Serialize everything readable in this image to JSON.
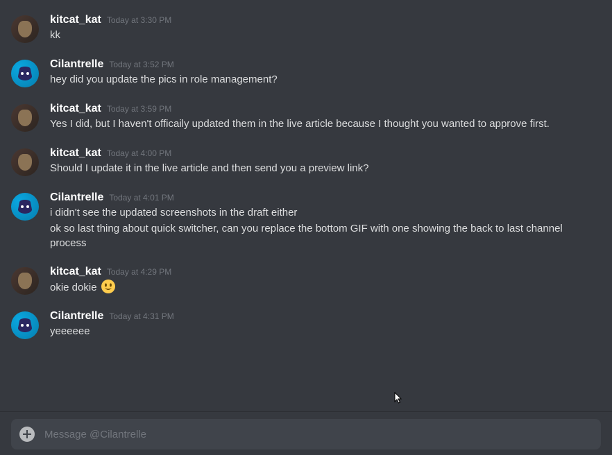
{
  "users": {
    "kitcat": {
      "name": "kitcat_kat"
    },
    "cilantrelle": {
      "name": "Cilantrelle"
    }
  },
  "messages": [
    {
      "user": "kitcat",
      "time": "Today at 3:30 PM",
      "lines": [
        "kk"
      ]
    },
    {
      "user": "cilantrelle",
      "time": "Today at 3:52 PM",
      "lines": [
        "hey did you update the pics in role management?"
      ]
    },
    {
      "user": "kitcat",
      "time": "Today at 3:59 PM",
      "lines": [
        "Yes I did, but I haven't officaily updated them in the live article because I thought you wanted to approve first."
      ]
    },
    {
      "user": "kitcat",
      "time": "Today at 4:00 PM",
      "lines": [
        "Should I update it in the live article and then send you a preview link?"
      ]
    },
    {
      "user": "cilantrelle",
      "time": "Today at 4:01 PM",
      "lines": [
        "i didn't see the updated screenshots in the draft either",
        "ok so last thing about quick switcher, can you replace the bottom GIF with one showing the back to last channel process"
      ]
    },
    {
      "user": "kitcat",
      "time": "Today at 4:29 PM",
      "lines": [
        "okie dokie "
      ],
      "emoji_after": true
    },
    {
      "user": "cilantrelle",
      "time": "Today at 4:31 PM",
      "lines": [
        "yeeeeee"
      ]
    }
  ],
  "input": {
    "placeholder": "Message @Cilantrelle"
  }
}
